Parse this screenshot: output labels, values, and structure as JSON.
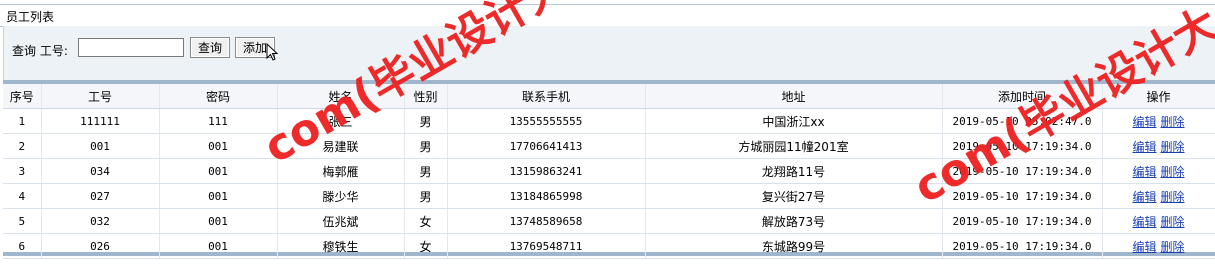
{
  "page_title": "员工列表",
  "search": {
    "label": "查询 工号:",
    "value": "",
    "query_label": "查询",
    "add_label": "添加"
  },
  "table": {
    "headers": [
      "序号",
      "工号",
      "密码",
      "姓名",
      "性别",
      "联系手机",
      "地址",
      "添加时间",
      "操作"
    ],
    "rows": [
      {
        "no": "1",
        "id": "111111",
        "pwd": "111",
        "name": "张三",
        "sex": "男",
        "phone": "13555555555",
        "addr": "中国浙江xx",
        "time": "2019-05-10 05:02:47.0",
        "edit": "编辑",
        "del": "删除"
      },
      {
        "no": "2",
        "id": "001",
        "pwd": "001",
        "name": "易建联",
        "sex": "男",
        "phone": "17706641413",
        "addr": "方城丽园11幢201室",
        "time": "2019-05-10 17:19:34.0",
        "edit": "编辑",
        "del": "删除"
      },
      {
        "no": "3",
        "id": "034",
        "pwd": "001",
        "name": "梅郭雁",
        "sex": "男",
        "phone": "13159863241",
        "addr": "龙翔路11号",
        "time": "2019-05-10 17:19:34.0",
        "edit": "编辑",
        "del": "删除"
      },
      {
        "no": "4",
        "id": "027",
        "pwd": "001",
        "name": "滕少华",
        "sex": "男",
        "phone": "13184865998",
        "addr": "复兴街27号",
        "time": "2019-05-10 17:19:34.0",
        "edit": "编辑",
        "del": "删除"
      },
      {
        "no": "5",
        "id": "032",
        "pwd": "001",
        "name": "伍兆斌",
        "sex": "女",
        "phone": "13748589658",
        "addr": "解放路73号",
        "time": "2019-05-10 17:19:34.0",
        "edit": "编辑",
        "del": "删除"
      },
      {
        "no": "6",
        "id": "026",
        "pwd": "001",
        "name": "穆铁生",
        "sex": "女",
        "phone": "13769548711",
        "addr": "东城路99号",
        "time": "2019-05-10 17:19:34.0",
        "edit": "编辑",
        "del": "删除"
      }
    ]
  },
  "watermarks": [
    "com(毕业设计大全)",
    "com(毕业设计大"
  ],
  "colors": {
    "link": "#1a3fb5",
    "watermark": "#ee2020",
    "border": "#9fb6cc"
  }
}
